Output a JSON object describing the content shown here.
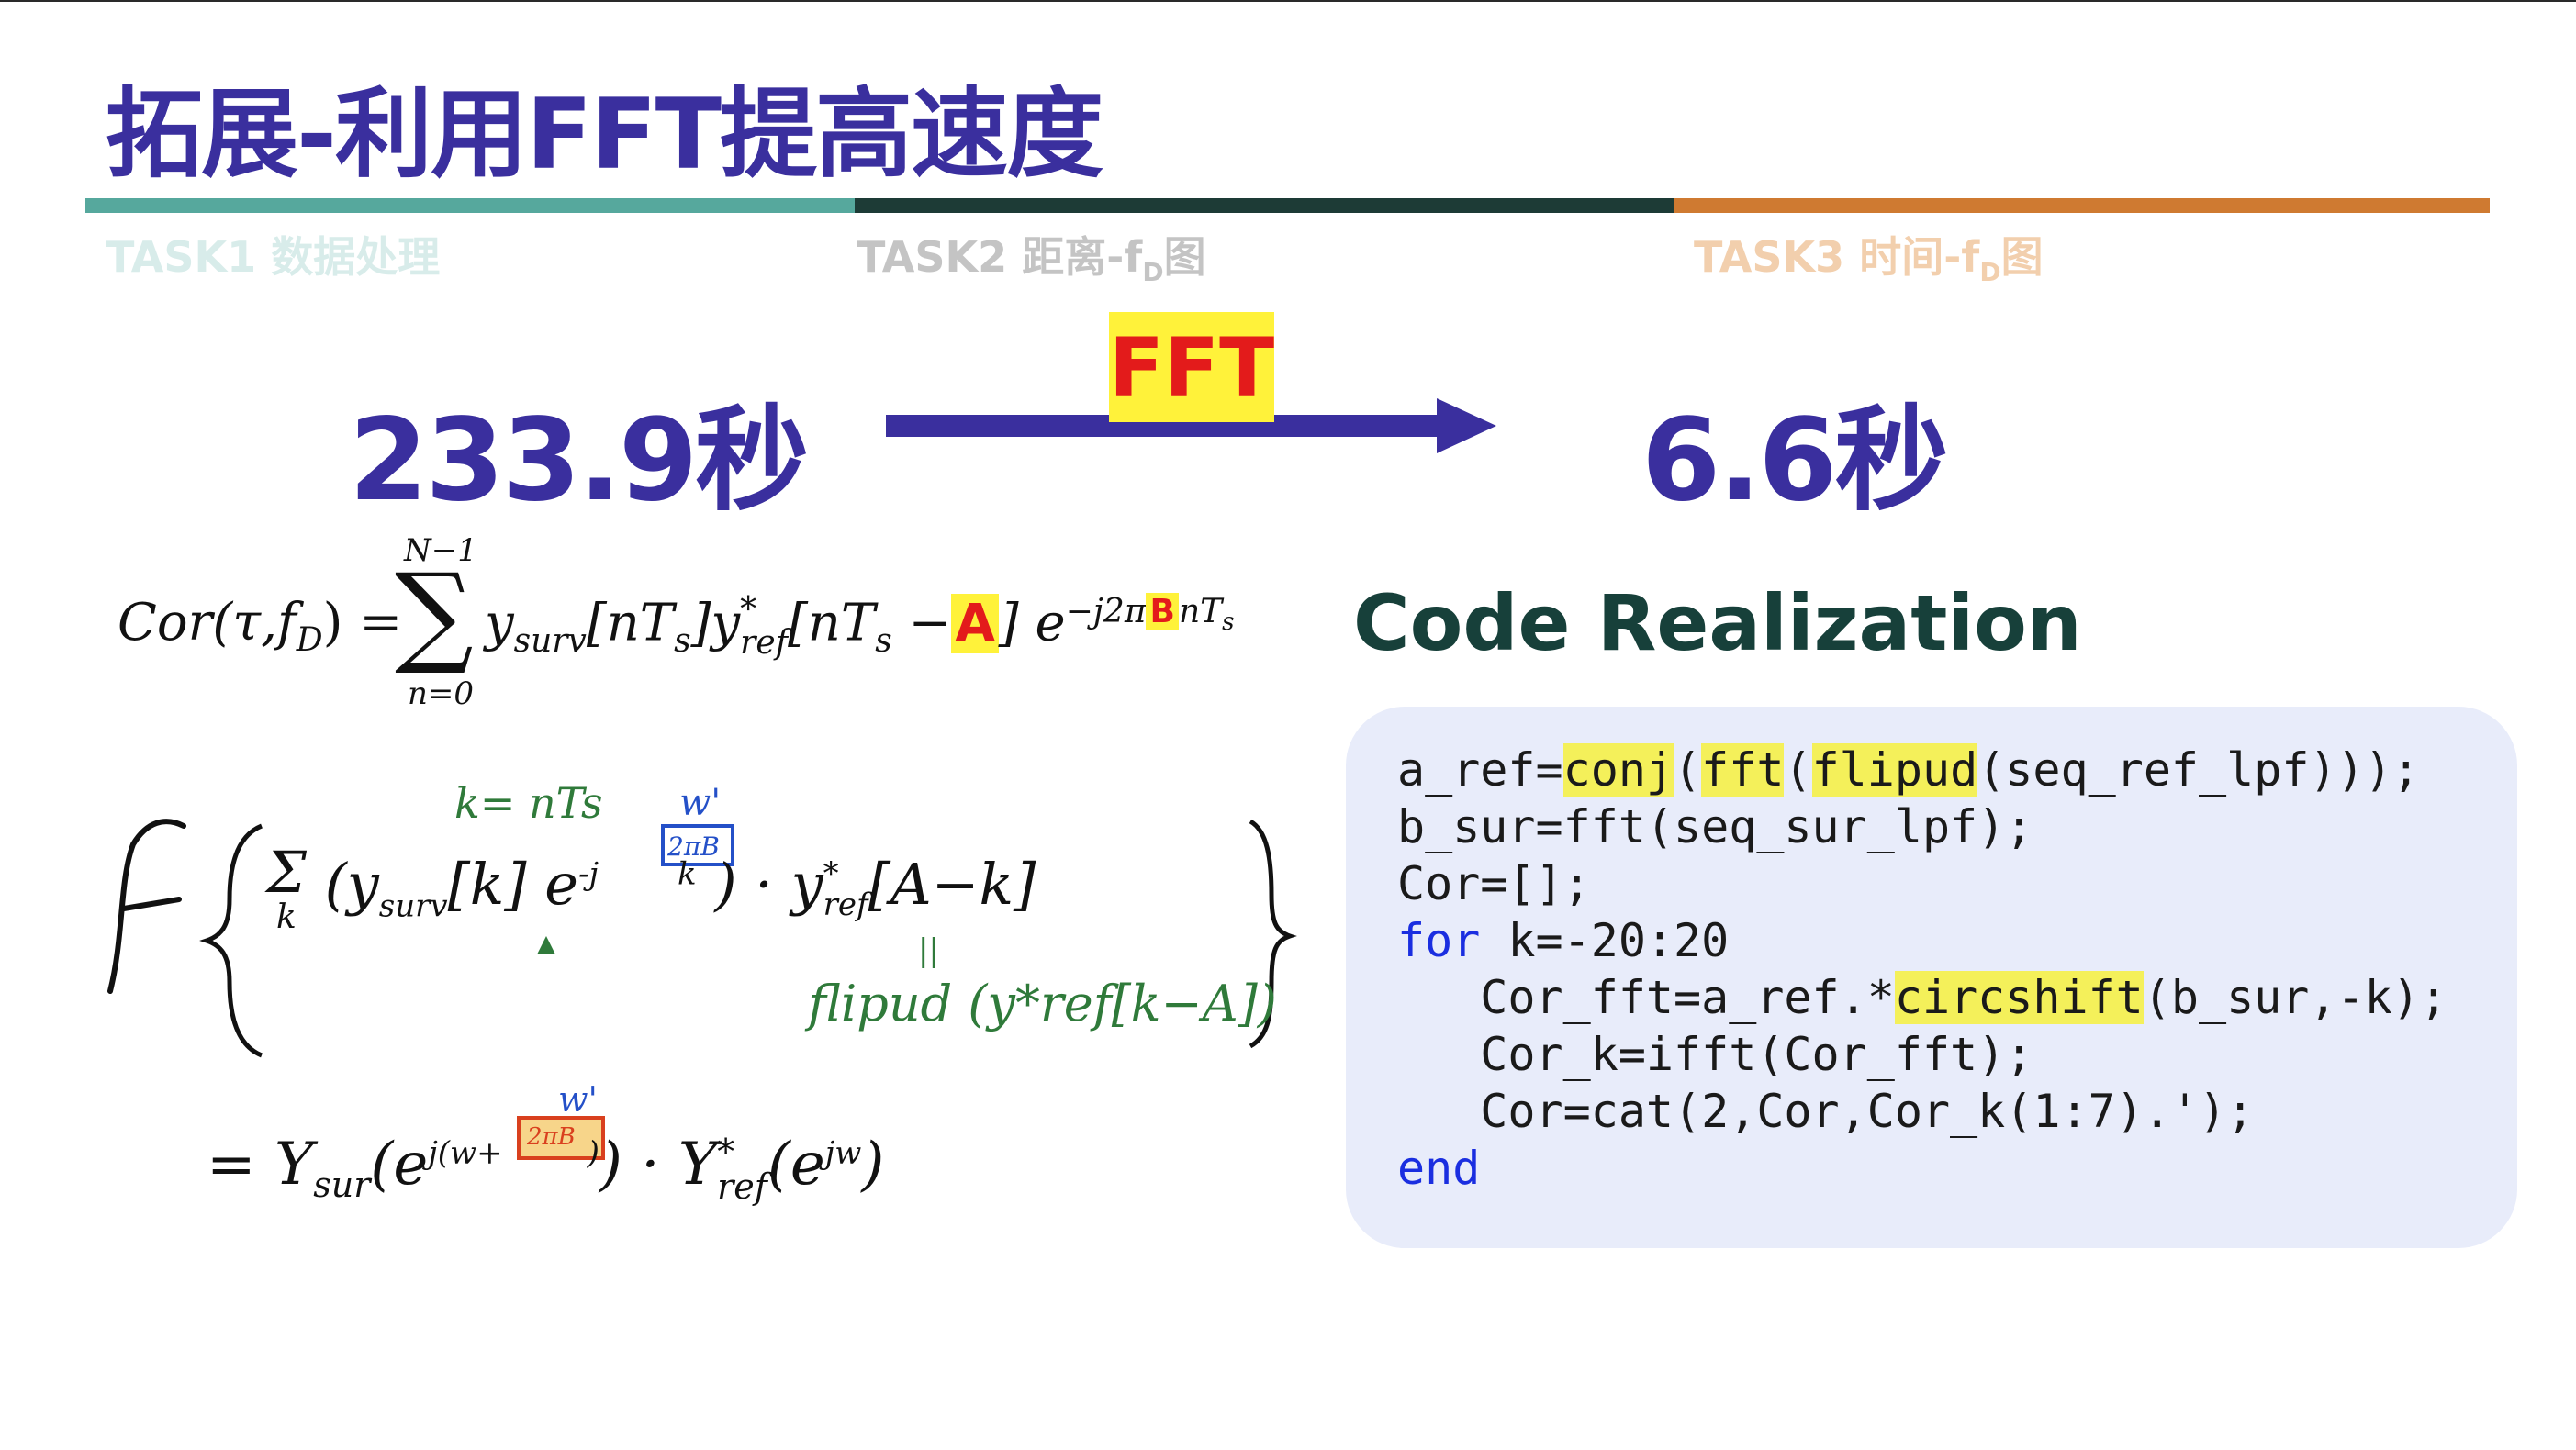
{
  "slide": {
    "title": "拓展-利用FFT提高速度"
  },
  "progress_tabs": [
    {
      "label": "TASK1 数据处理",
      "bar_color": "#56a89d",
      "text_color": "#d8ecea"
    },
    {
      "label": "TASK2 距离-f",
      "sub": "D",
      "suffix": "图",
      "bar_color": "#1d3b36",
      "text_color": "#c4c4c4"
    },
    {
      "label": "TASK3 时间-f",
      "sub": "D",
      "suffix": "图",
      "bar_color": "#cf7a31",
      "text_color": "#f2cfad"
    }
  ],
  "speed": {
    "before": "233.9秒",
    "method": "FFT",
    "after": "6.6秒"
  },
  "formula": {
    "lhs": "Cor(τ,f",
    "lhs_sub": "D",
    "lhs_end": ") =",
    "sum_top": "N−1",
    "sum_bottom": "n=0",
    "term1": "y",
    "term1_sub": "surv",
    "term1_arg": "[nT",
    "term1_arg_sub": "s",
    "term1_arg_end": "]",
    "term2": "y",
    "term2_sup": "*",
    "term2_sub": "ref",
    "term2_arg": "[nT",
    "term2_arg_sub": "s",
    "term2_arg_mid": " −",
    "box_a": "A",
    "term2_arg_end": "]",
    "exp_base": "e",
    "exp_power": "−j2π",
    "box_b": "B",
    "exp_tail": "nT",
    "exp_tail_sub": "s"
  },
  "handwriting": {
    "k_note": "k= nTs",
    "w_prime_1": "w'",
    "w_prime_2": "w'",
    "box_2pib": "2πB",
    "line1_sum": "Σ",
    "line1_sum_sub": "k",
    "line1_a": "(y",
    "line1_a_sub": "surv",
    "line1_b": "[k] e",
    "line1_exp": "-j",
    "line1_exp_tail": "k",
    "line1_c": ") · y",
    "line1_c_sup": "*",
    "line1_c_sub": "ref",
    "line1_d": "[A−k]",
    "equals_mark": "||",
    "flipud_note": "flipud (y*ref[k−A])",
    "line2_eq": "=",
    "line2_a": "Y",
    "line2_a_sub": "sur",
    "line2_b": "(e",
    "line2_exp": "j(w+",
    "line2_exp_close": ")",
    "line2_c": ") · Y",
    "line2_c_sup": "*",
    "line2_c_sub": "ref",
    "line2_d": "(e",
    "line2_d_exp": "jw",
    "line2_e": ")"
  },
  "code": {
    "title": "Code Realization",
    "lines": [
      "a_ref=conj(fft(flipud(seq_ref_lpf)));",
      "b_sur=fft(seq_sur_lpf);",
      "Cor=[];",
      "for k=-20:20",
      "   Cor_fft=a_ref.*circshift(b_sur,-k);",
      "   Cor_k=ifft(Cor_fft);",
      "   Cor=cat(2,Cor,Cor_k(1:7).');",
      "end"
    ],
    "tokens": {
      "l0_a": "a_ref=",
      "l0_conj": "conj",
      "l0_p1": "(",
      "l0_fft": "fft",
      "l0_p2": "(",
      "l0_flipud": "flipud",
      "l0_rest": "(seq_ref_lpf)));",
      "l1": "b_sur=fft(seq_sur_lpf);",
      "l2": "Cor=[];",
      "l3_for": "for",
      "l3_rest": " k=-20:20",
      "l4_a": "   Cor_fft=a_ref.*",
      "l4_circ": "circshift",
      "l4_rest": "(b_sur,-k);",
      "l5": "   Cor_k=ifft(Cor_fft);",
      "l6": "   Cor=cat(2,Cor,Cor_k(1:7).');",
      "l7_end": "end"
    },
    "keyword_color": "#1a2ee0",
    "highlight_color": "#f4f05a"
  }
}
